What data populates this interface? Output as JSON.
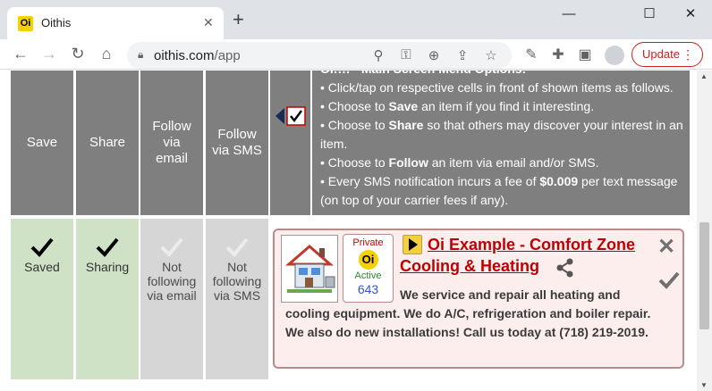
{
  "browser": {
    "tab_favicon": "Oi",
    "tab_title": "Oithis",
    "tab_close": "✕",
    "new_tab": "+",
    "url_host": "oithis.com",
    "url_path": "/app",
    "update_label": "Update",
    "window_controls": {
      "minimize": "—",
      "maximize": "☐",
      "close": "✕"
    }
  },
  "header": {
    "columns": [
      "Save",
      "Share",
      "Follow via email",
      "Follow via SMS"
    ],
    "instructions": {
      "top_partial": "Oi!!!! - Main Screen Menu Options:",
      "line1": "• Click/tap on respective cells in front of shown items as follows.",
      "line2_pre": "• Choose to ",
      "line2_bold": "Save",
      "line2_post": " an item if you find it interesting.",
      "line3_pre": "• Choose to ",
      "line3_bold": "Share",
      "line3_post": " so that others may discover your interest in an item.",
      "line4_pre": "• Choose to ",
      "line4_bold": "Follow",
      "line4_post": " an item via email and/or SMS.",
      "line5_pre": "• Every SMS notification incurs a fee of ",
      "line5_bold": "$0.009",
      "line5_post": " per text message (on top of your carrier fees if any)."
    }
  },
  "states": {
    "save": "Saved",
    "share": "Sharing",
    "email": "Not following via email",
    "sms": "Not following via SMS"
  },
  "item": {
    "badge_private": "Private",
    "badge_logo": "Oi",
    "badge_status": "Active",
    "badge_count": "643",
    "title": "Oi Example - Comfort Zone Cooling & Heating",
    "description": "We service and repair all heating and cooling equipment. We do A/C, refrigeration and boiler repair. We also do new installations! Call us today at (718) 219-2019."
  },
  "colors": {
    "header_grey": "#7f7f7f",
    "active_green": "#cfe2c6",
    "inactive_grey": "#d6d6d6",
    "title_red": "#c00000",
    "update_red": "#c5221f"
  }
}
